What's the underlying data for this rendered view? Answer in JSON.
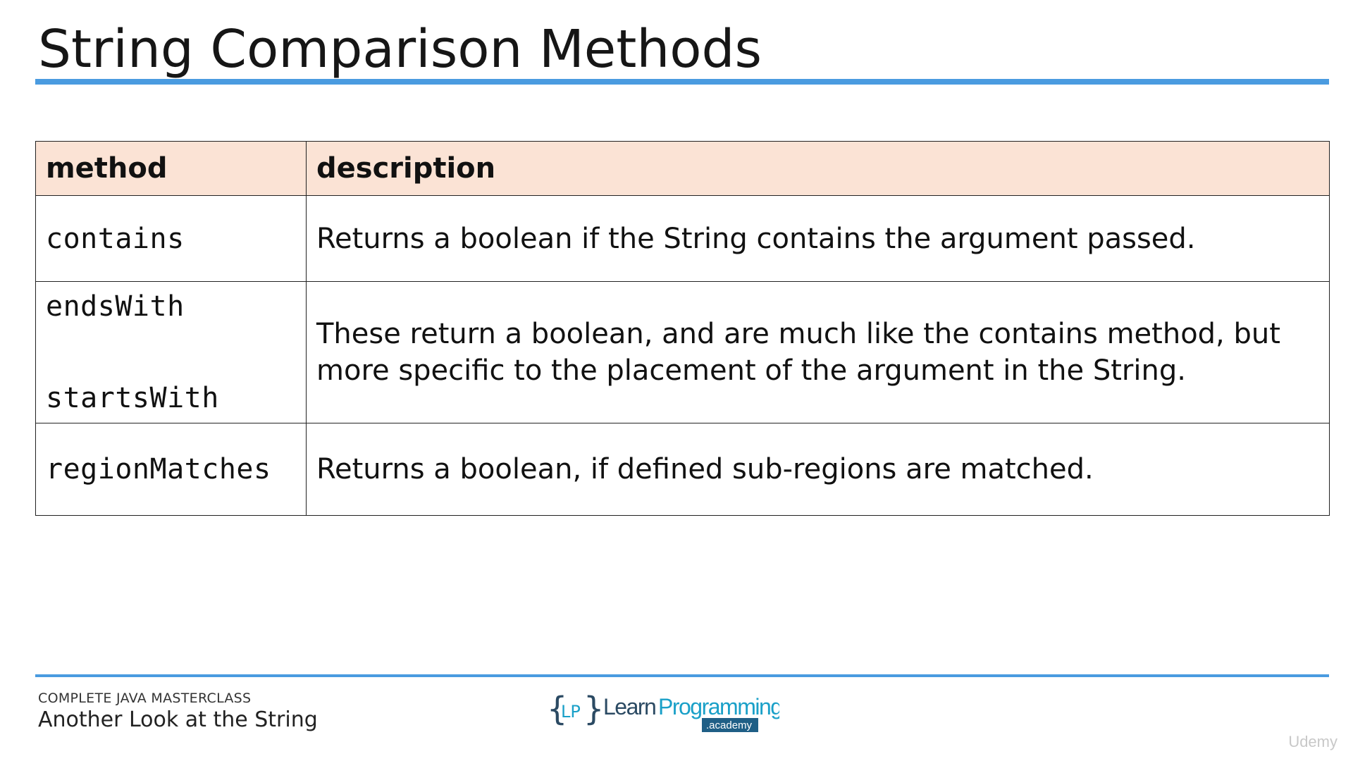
{
  "slide": {
    "title": "String Comparison Methods"
  },
  "table": {
    "headers": [
      "method",
      "description"
    ],
    "rows": [
      {
        "methods": [
          "contains"
        ],
        "description": "Returns a boolean if the String contains the argument passed."
      },
      {
        "methods": [
          "endsWith",
          "startsWith"
        ],
        "description": "These return a boolean, and are much like the contains method, but more specific to the placement of the argument in the String."
      },
      {
        "methods": [
          "regionMatches"
        ],
        "description": "Returns a boolean, if defined sub-regions are matched."
      }
    ],
    "header_bg": "#fbe3d5"
  },
  "footer": {
    "course": "COMPLETE JAVA MASTERCLASS",
    "lecture": "Another Look at the String",
    "logo_text": "{LP} LearnProgramming .academy",
    "watermark": "Udemy"
  },
  "colors": {
    "accent": "#4a9be0",
    "logo_teal": "#1aa0c8",
    "logo_dark": "#2b4a63"
  }
}
